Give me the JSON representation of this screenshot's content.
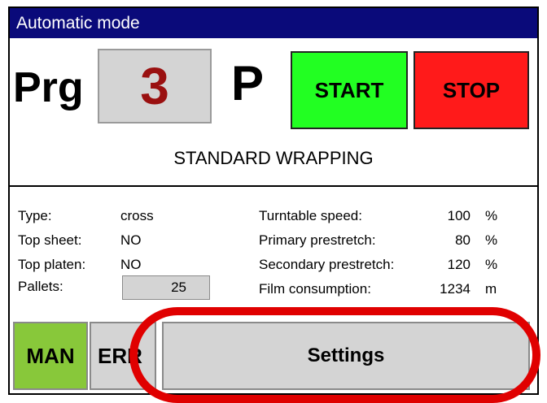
{
  "window": {
    "title": "Automatic mode"
  },
  "program": {
    "label": "Prg",
    "number": "3",
    "mode_letter": "P",
    "name": "STANDARD WRAPPING"
  },
  "controls": {
    "start_label": "START",
    "stop_label": "STOP"
  },
  "info_left": [
    {
      "label": "Type:",
      "value": "cross"
    },
    {
      "label": "Top sheet:",
      "value": "NO"
    },
    {
      "label": "Top platen:",
      "value": "NO"
    },
    {
      "label": "Pallets:",
      "value": "25"
    }
  ],
  "info_right": [
    {
      "label": "Turntable speed:",
      "value": "100",
      "unit": "%"
    },
    {
      "label": "Primary prestretch:",
      "value": "80",
      "unit": "%"
    },
    {
      "label": "Secondary prestretch:",
      "value": "120",
      "unit": "%"
    },
    {
      "label": "Film consumption:",
      "value": "1234",
      "unit": "m"
    }
  ],
  "bottom_bar": {
    "man_label": "MAN",
    "err_label": "ERR",
    "settings_label": "Settings"
  },
  "colors": {
    "title_bg": "#0a0a7a",
    "start": "#22ff22",
    "stop": "#ff1a1a",
    "man": "#88c83a",
    "highlight": "#e00000"
  }
}
